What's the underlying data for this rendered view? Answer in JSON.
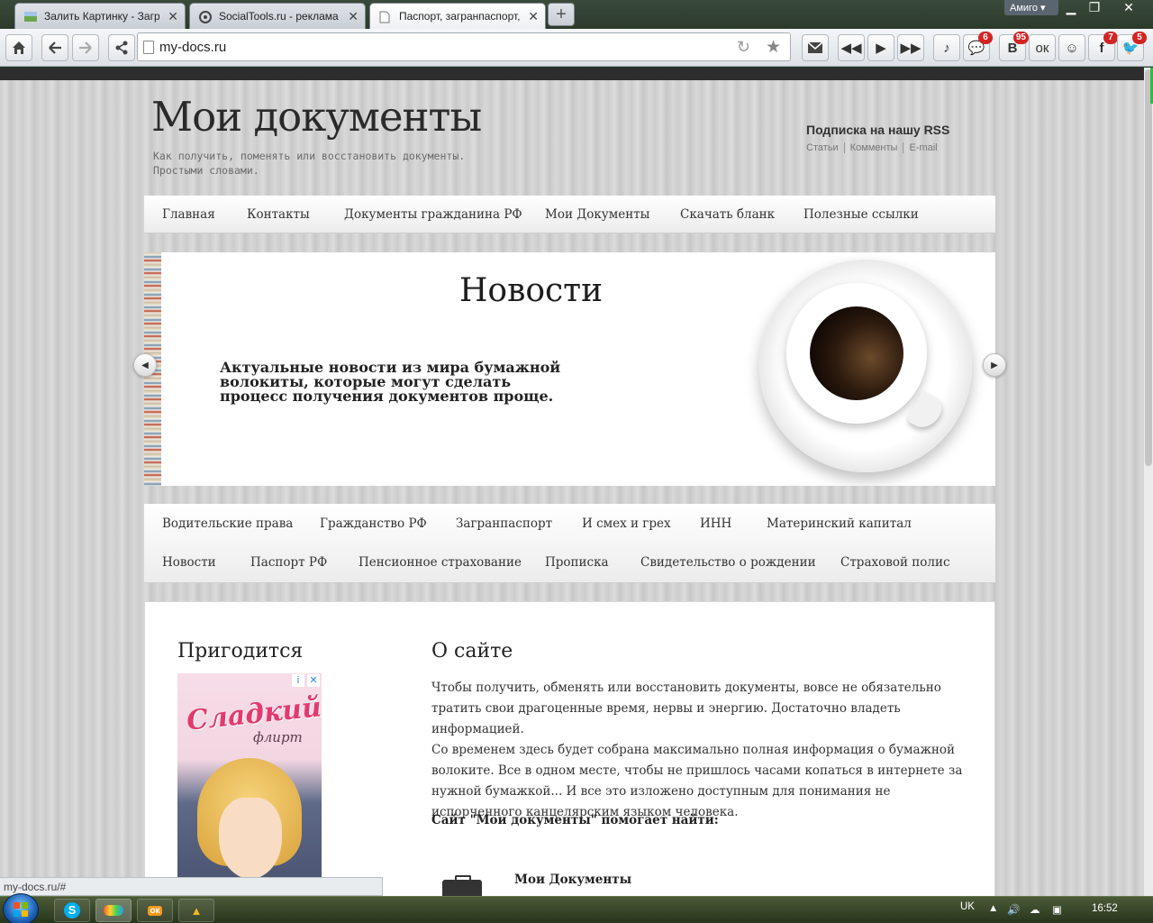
{
  "browser": {
    "tabs": [
      {
        "title": "Залить Картинку - Загрузи",
        "favicon": "image-favicon-icon"
      },
      {
        "title": "SocialTools.ru - реклама в с",
        "favicon": "socialtools-favicon-icon"
      },
      {
        "title": "Паспорт, загранпаспорт, ви",
        "favicon": "page-favicon-icon",
        "active": true
      }
    ],
    "new_tab_symbol": "+",
    "profile_label": "Амиго",
    "url": "my-docs.ru",
    "badges": {
      "messages": "6",
      "vk": "95",
      "facebook": "7",
      "twitter": "5"
    },
    "status_url": "my-docs.ru/#"
  },
  "site": {
    "title": "Мои документы",
    "description": "Как получить, поменять или восстановить документы. Простыми словами.",
    "rss_title": "Подписка на нашу RSS",
    "rss_links": [
      "Статьи",
      "Комменты",
      "E-mail"
    ],
    "nav": [
      "Главная",
      "Контакты",
      "Документы гражданина РФ",
      "Мои Документы",
      "Скачать бланк",
      "Полезные ссылки"
    ],
    "slider": {
      "title": "Новости",
      "text": "Актуальные новости из мира бумажной волокиты, которые могут сделать процесс получения документов проще."
    },
    "categories_row1": [
      "Водительские права",
      "Гражданство РФ",
      "Загранпаспорт",
      "И смех и грех",
      "ИНН",
      "Материнский капитал"
    ],
    "categories_row2": [
      "Новости",
      "Паспорт РФ",
      "Пенсионное страхование",
      "Прописка",
      "Свидетельство о рождении",
      "Страховой полис"
    ],
    "sidebar_title": "Пригодится",
    "ad": {
      "title": "Сладкий",
      "subtitle": "флирт",
      "icons": [
        "i",
        "✕"
      ]
    },
    "about_title": "О сайте",
    "about_p1": "Чтобы получить, обменять или восстановить документы, вовсе не обязательно тратить свои драгоценные время, нервы и энергию. Достаточно владеть информацией.",
    "about_p2": "Со временем здесь будет собрана максимально полная информация о бумажной волоките. Все в одном месте, чтобы не пришлось часами копаться в интернете за нужной бумажкой... И все это изложено доступным для понимания не испорченного канцелярским языком человека.",
    "about_help": "Сайт \"Мои документы\" помогает найти:",
    "help_item": "Мои Документы"
  },
  "taskbar": {
    "apps": [
      "S",
      "",
      "ок",
      "▲"
    ],
    "lang": "UK",
    "time": "16:52"
  }
}
